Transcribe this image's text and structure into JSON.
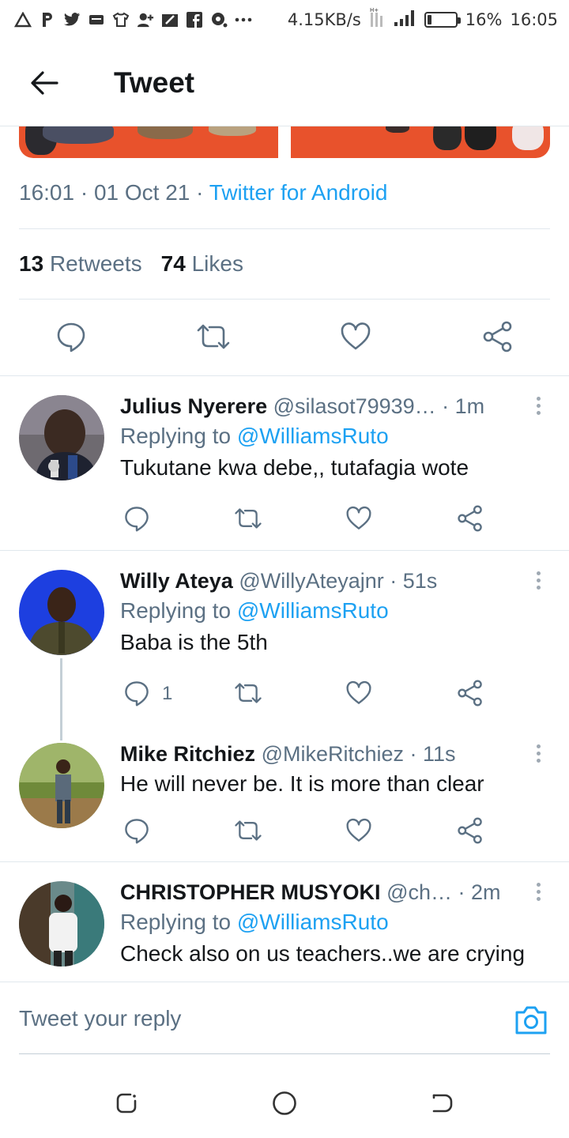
{
  "status_bar": {
    "speed": "4.15KB/s",
    "battery": "16%",
    "battery_level": 0.16,
    "time": "16:05",
    "icons": [
      "alert-icon",
      "p-icon",
      "twitter-icon",
      "message-icon",
      "shirt-icon",
      "add-contact-icon",
      "edit-icon",
      "facebook-icon",
      "chat-icon",
      "more-icon",
      "network-icon",
      "signal-icon",
      "battery-icon"
    ]
  },
  "header": {
    "title": "Tweet",
    "back_icon": "arrow-left-icon"
  },
  "tweet": {
    "time": "16:01",
    "date": "01 Oct 21",
    "sep": " · ",
    "source": "Twitter for Android",
    "retweets_count": "13",
    "retweets_label": "Retweets",
    "likes_count": "74",
    "likes_label": "Likes",
    "actions": [
      "reply-icon",
      "retweet-icon",
      "like-icon",
      "share-icon"
    ]
  },
  "replies": [
    {
      "name": "Julius Nyerere",
      "handle": "@silasot79939…",
      "time": "· 1m",
      "replying_prefix": "Replying to",
      "replying_to": "@WilliamsRuto",
      "text": "Tukutane kwa debe,, tutafagia wote",
      "reply_count": ""
    },
    {
      "name": "Willy Ateya",
      "handle": "@WillyAteyajnr",
      "time": "· 51s",
      "replying_prefix": "Replying to",
      "replying_to": "@WilliamsRuto",
      "text": "Baba is the 5th",
      "reply_count": "1"
    },
    {
      "name": "Mike Ritchiez",
      "handle": "@MikeRitchiez",
      "time": "· 11s",
      "text": "He will never be. It is more than clear",
      "reply_count": ""
    },
    {
      "name": "CHRISTOPHER MUSYOKI",
      "handle": "@ch…",
      "time": "· 2m",
      "replying_prefix": "Replying to",
      "replying_to": "@WilliamsRuto",
      "text": "Check also on us teachers..we are crying"
    }
  ],
  "composer": {
    "placeholder": "Tweet your reply",
    "camera_icon": "camera-icon"
  },
  "navbar": {
    "icons": [
      "recents-icon",
      "home-icon",
      "back-icon"
    ]
  },
  "colors": {
    "accent": "#1da1f2",
    "text": "#14171a",
    "secondary": "#5b7083",
    "divider": "#e1e8ed"
  }
}
